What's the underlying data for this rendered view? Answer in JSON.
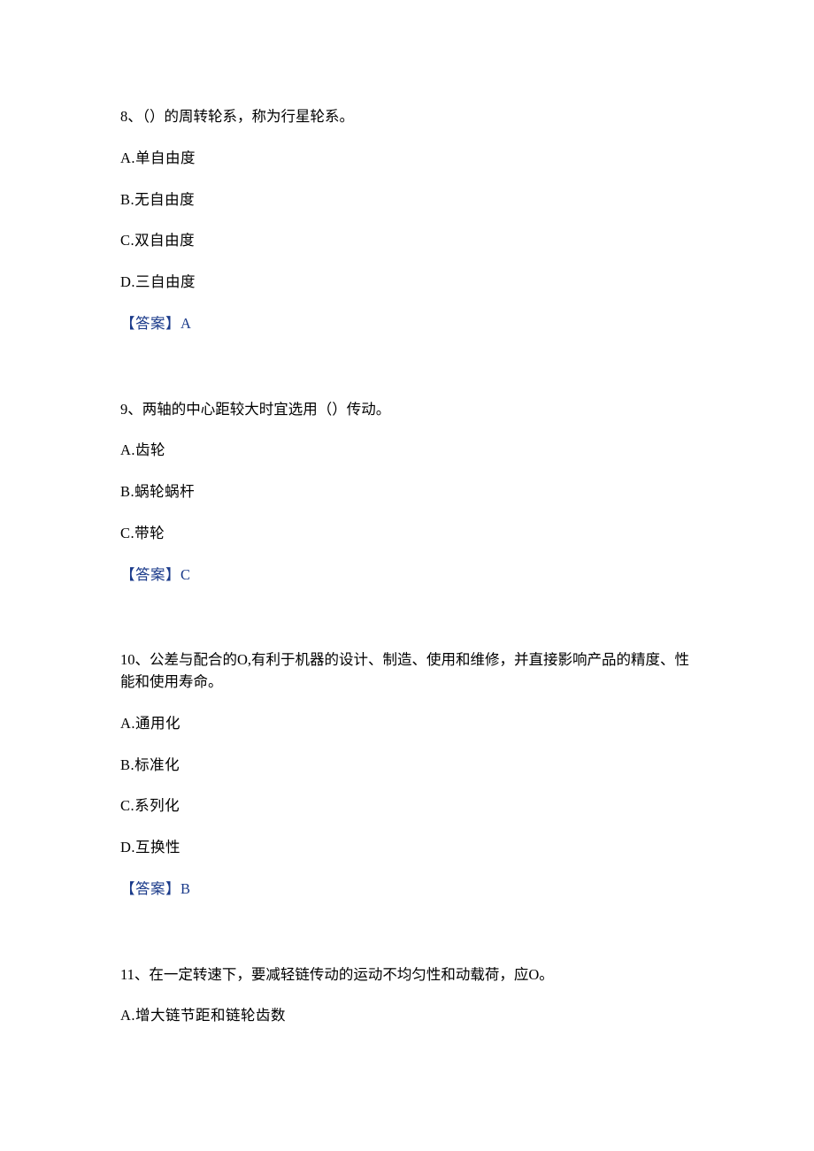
{
  "questions": [
    {
      "number": "8、",
      "text": "（）的周转轮系，称为行星轮系。",
      "options": [
        {
          "label": "A.",
          "text": "单自由度"
        },
        {
          "label": "B.",
          "text": "无自由度"
        },
        {
          "label": "C.",
          "text": "双自由度"
        },
        {
          "label": "D.",
          "text": "三自由度"
        }
      ],
      "answer_label": "【答案】",
      "answer_value": "A"
    },
    {
      "number": "9、",
      "text": "两轴的中心距较大时宜选用（）传动。",
      "options": [
        {
          "label": "A.",
          "text": "齿轮"
        },
        {
          "label": "B.",
          "text": "蜗轮蜗杆"
        },
        {
          "label": "C.",
          "text": "带轮"
        }
      ],
      "answer_label": "【答案】",
      "answer_value": "C"
    },
    {
      "number": "10、",
      "text": "公差与配合的O,有利于机器的设计、制造、使用和维修，并直接影响产品的精度、性能和使用寿命。",
      "options": [
        {
          "label": "A.",
          "text": "通用化"
        },
        {
          "label": "B.",
          "text": "标准化"
        },
        {
          "label": "C.",
          "text": "系列化"
        },
        {
          "label": "D.",
          "text": "互换性"
        }
      ],
      "answer_label": "【答案】",
      "answer_value": "B"
    },
    {
      "number": "11、",
      "text": "在一定转速下，要减轻链传动的运动不均匀性和动载荷，应O。",
      "options": [
        {
          "label": "A.",
          "text": "增大链节距和链轮齿数"
        }
      ],
      "answer_label": "",
      "answer_value": ""
    }
  ]
}
